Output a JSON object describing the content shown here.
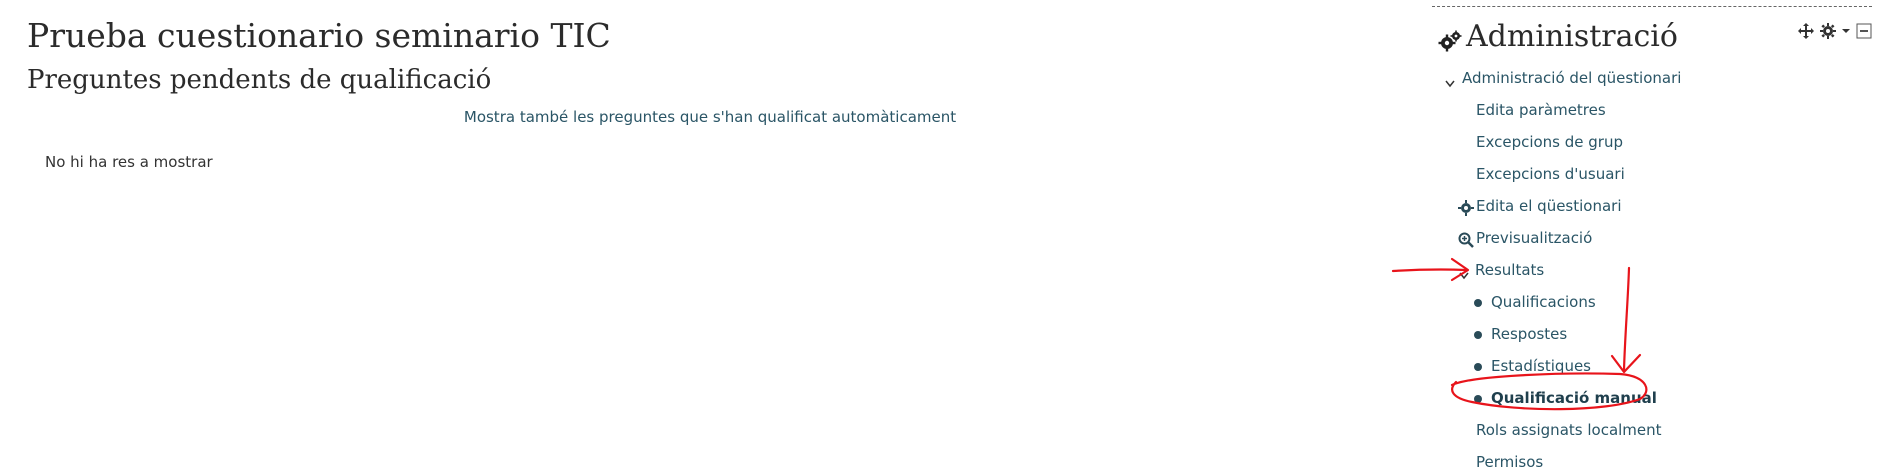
{
  "main": {
    "title": "Prueba cuestionario seminario TIC",
    "subtitle": "Preguntes pendents de qualificació",
    "show_auto_link": "Mostra també les preguntes que s'han qualificat automàticament",
    "empty_message": "No hi ha res a mostrar"
  },
  "admin": {
    "title": "Administració",
    "icon": "gears-icon",
    "controls": [
      "move-icon",
      "gear-icon",
      "caret-down-icon",
      "collapse-icon"
    ],
    "items": [
      {
        "label": "Administració del qüestionari",
        "icon": "chevron-down-icon"
      },
      {
        "label": "Edita paràmetres"
      },
      {
        "label": "Excepcions de grup"
      },
      {
        "label": "Excepcions d'usuari"
      },
      {
        "label": "Edita el qüestionari",
        "icon": "gear-icon"
      },
      {
        "label": "Previsualització",
        "icon": "zoom-icon"
      },
      {
        "label": "Resultats",
        "icon": "chevron-down-icon"
      },
      {
        "label": "Qualificacions",
        "icon": "bullet-icon"
      },
      {
        "label": "Respostes",
        "icon": "bullet-icon"
      },
      {
        "label": "Estadístiques",
        "icon": "bullet-icon"
      },
      {
        "label": "Qualificació manual",
        "icon": "bullet-icon",
        "active": true
      },
      {
        "label": "Rols assignats localment"
      },
      {
        "label": "Permisos"
      }
    ]
  },
  "colors": {
    "link": "#2a5566",
    "annotation": "#e8141b"
  }
}
